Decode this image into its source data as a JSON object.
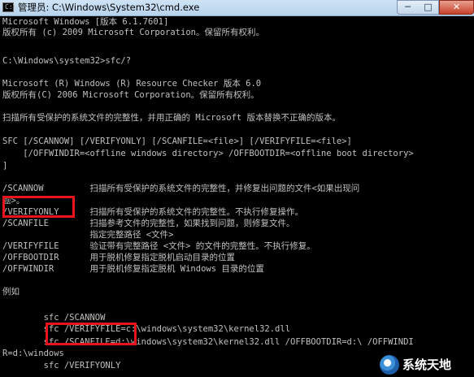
{
  "window": {
    "title": "管理员: C:\\Windows\\System32\\cmd.exe",
    "minimize_glyph": "─",
    "maximize_glyph": "□",
    "close_glyph": "✕",
    "icon_prompt": "C:\\"
  },
  "console": {
    "lines": [
      "Microsoft Windows [版本 6.1.7601]",
      "版权所有 (c) 2009 Microsoft Corporation。保留所有权利。",
      "",
      "C:\\Windows\\system32>sfc/?",
      "",
      "Microsoft (R) Windows (R) Resource Checker 版本 6.0",
      "版权所有(C) 2006 Microsoft Corporation。保留所有权利。",
      "",
      "扫描所有受保护的系统文件的完整性，并用正确的 Microsoft 版本替换不正确的版本。",
      "",
      "SFC [/SCANNOW] [/VERIFYONLY] [/SCANFILE=<file>] [/VERIFYFILE=<file>]",
      "    [/OFFWINDIR=<offline windows directory> /OFFBOOTDIR=<offline boot directory>",
      "]",
      "",
      "/SCANNOW         扫描所有受保护的系统文件的完整性，并修复出问题的文件<如果出现问",
      "题>。",
      "/VERIFYONLY      扫描所有受保护的系统文件的完整性。不执行修复操作。",
      "/SCANFILE        扫描参考文件的完整性，如果找到问题，则修复文件。",
      "                 指定完整路径 <文件>",
      "/VERIFYFILE      验证带有完整路径 <文件> 的文件的完整性。不执行修复。",
      "/OFFBOOTDIR      用于脱机修复指定脱机启动目录的位置",
      "/OFFWINDIR       用于脱机修复指定脱机 Windows 目录的位置",
      "",
      "例如",
      "",
      "        sfc /SCANNOW",
      "        sfc /VERIFYFILE=c:\\windows\\system32\\kernel32.dll",
      "        sfc /SCANFILE=d:\\windows\\system32\\kernel32.dll /OFFBOOTDIR=d:\\ /OFFWINDI",
      "R=d:\\windows",
      "        sfc /VERIFYONLY"
    ]
  },
  "watermark": {
    "text": "系统天地"
  },
  "colors": {
    "console_bg": "#000000",
    "console_text": "#c0c0c0",
    "highlight": "#e8141b",
    "titlebar": "#cfe3f5"
  }
}
